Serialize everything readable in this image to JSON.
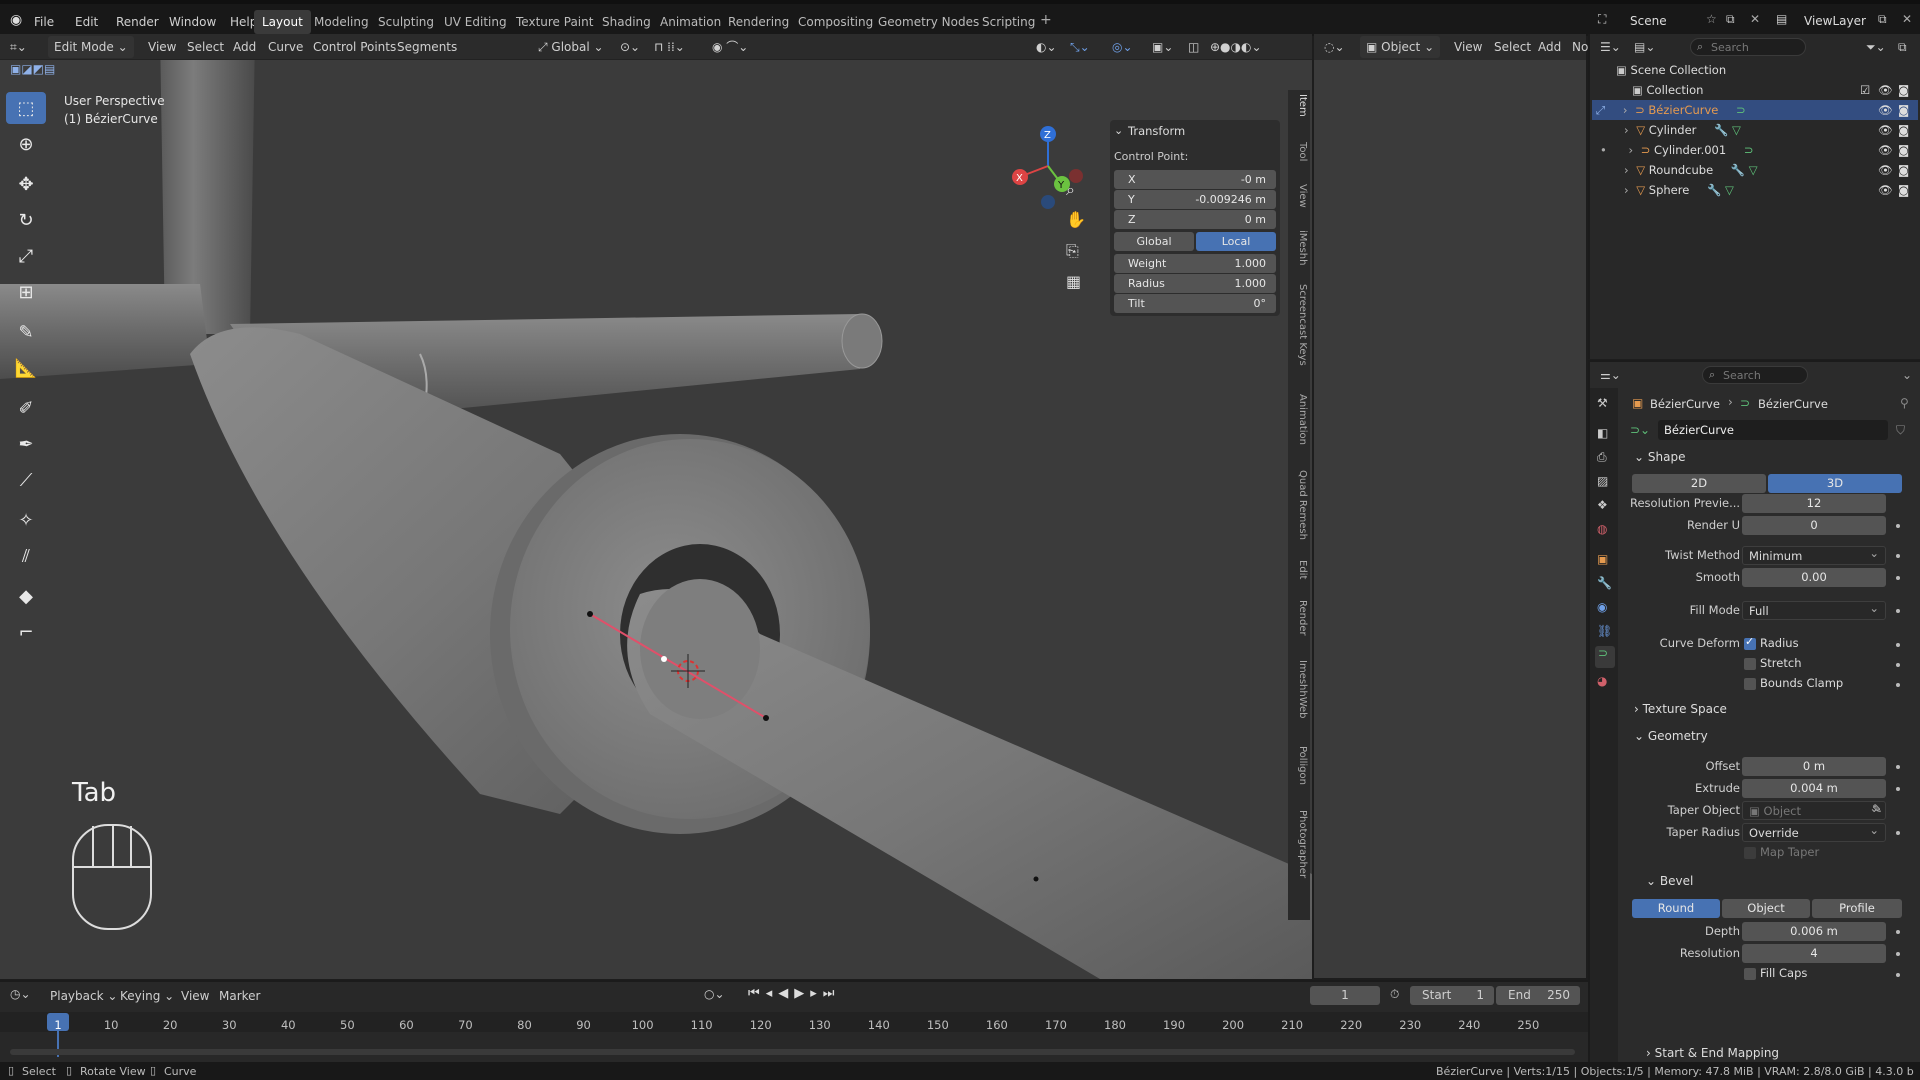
{
  "app": {
    "menus": [
      "File",
      "Edit",
      "Render",
      "Window",
      "Help"
    ],
    "workspaces": [
      "Layout",
      "Modeling",
      "Sculpting",
      "UV Editing",
      "Texture Paint",
      "Shading",
      "Animation",
      "Rendering",
      "Compositing",
      "Geometry Nodes",
      "Scripting"
    ],
    "active_workspace": "Layout",
    "scene": "Scene",
    "view_layer": "ViewLayer"
  },
  "viewport_header": {
    "mode": "Edit Mode",
    "menus": [
      "View",
      "Select",
      "Add",
      "Curve",
      "Control Points",
      "Segments"
    ],
    "orientation": "Global"
  },
  "viewport": {
    "perspective": "User Perspective",
    "object_label": "(1) BézierCurve",
    "key_overlay": "Tab"
  },
  "transform_panel": {
    "title": "Transform",
    "subtitle": "Control Point:",
    "x_label": "X",
    "x_value": "-0 m",
    "y_label": "Y",
    "y_value": "-0.009246 m",
    "z_label": "Z",
    "z_value": "0 m",
    "global_label": "Global",
    "local_label": "Local",
    "weight_label": "Weight",
    "weight_value": "1.000",
    "radius_label": "Radius",
    "radius_value": "1.000",
    "tilt_label": "Tilt",
    "tilt_value": "0°"
  },
  "sidebar_tabs": [
    "Item",
    "Tool",
    "View",
    "iMeshh",
    "Screencast Keys",
    "Animation",
    "Quad Remesh",
    "Edit",
    "Render",
    "ImeshhWeb",
    "Polligon",
    "Photographer"
  ],
  "second_view_header": {
    "mode": "Object",
    "menus": [
      "View",
      "Select",
      "Add",
      "No"
    ]
  },
  "outliner": {
    "search_placeholder": "Search",
    "scene_collection": "Scene Collection",
    "collection": "Collection",
    "items": [
      {
        "name": "BézierCurve",
        "selected": true
      },
      {
        "name": "Cylinder",
        "selected": false
      },
      {
        "name": "Cylinder.001",
        "selected": false
      },
      {
        "name": "Roundcube",
        "selected": false
      },
      {
        "name": "Sphere",
        "selected": false
      }
    ]
  },
  "properties": {
    "search_placeholder": "Search",
    "breadcrumb_object": "BézierCurve",
    "breadcrumb_data": "BézierCurve",
    "datablock_name": "BézierCurve",
    "shape": {
      "title": "Shape",
      "dim_2d": "2D",
      "dim_3d": "3D",
      "resolution_preview_label": "Resolution Previe...",
      "resolution_preview_value": "12",
      "render_u_label": "Render U",
      "render_u_value": "0",
      "twist_method_label": "Twist Method",
      "twist_method_value": "Minimum",
      "smooth_label": "Smooth",
      "smooth_value": "0.00",
      "fill_mode_label": "Fill Mode",
      "fill_mode_value": "Full",
      "curve_deform_label": "Curve Deform",
      "radius_label": "Radius",
      "stretch_label": "Stretch",
      "bounds_clamp_label": "Bounds Clamp"
    },
    "texture_space": "Texture Space",
    "geometry": {
      "title": "Geometry",
      "offset_label": "Offset",
      "offset_value": "0 m",
      "extrude_label": "Extrude",
      "extrude_value": "0.004 m",
      "taper_object_label": "Taper Object",
      "taper_object_placeholder": "Object",
      "taper_radius_label": "Taper Radius",
      "taper_radius_value": "Override",
      "map_taper_label": "Map Taper"
    },
    "bevel": {
      "title": "Bevel",
      "round": "Round",
      "object": "Object",
      "profile": "Profile",
      "depth_label": "Depth",
      "depth_value": "0.006 m",
      "resolution_label": "Resolution",
      "resolution_value": "4",
      "fill_caps_label": "Fill Caps"
    },
    "start_end_mapping": "Start & End Mapping"
  },
  "timeline": {
    "menus": [
      "Playback",
      "Keying",
      "View",
      "Marker"
    ],
    "current_frame": "1",
    "start_label": "Start",
    "start_value": "1",
    "end_label": "End",
    "end_value": "250",
    "ticks": [
      "1",
      "10",
      "20",
      "30",
      "40",
      "50",
      "60",
      "70",
      "80",
      "90",
      "100",
      "110",
      "120",
      "130",
      "140",
      "150",
      "160",
      "170",
      "180",
      "190",
      "200",
      "210",
      "220",
      "230",
      "240",
      "250"
    ]
  },
  "statusbar": {
    "select": "Select",
    "rotate_view": "Rotate View",
    "curve": "Curve",
    "info": "BézierCurve | Verts:1/15 | Objects:1/5 | Memory: 47.8 MiB | VRAM: 2.8/8.0 GiB | 4.3.0 b"
  },
  "colors": {
    "accent": "#4772b3",
    "selected_row": "#334d80",
    "viewport_bg": "#3b3b3b",
    "curve_handle": "#e0506a"
  }
}
